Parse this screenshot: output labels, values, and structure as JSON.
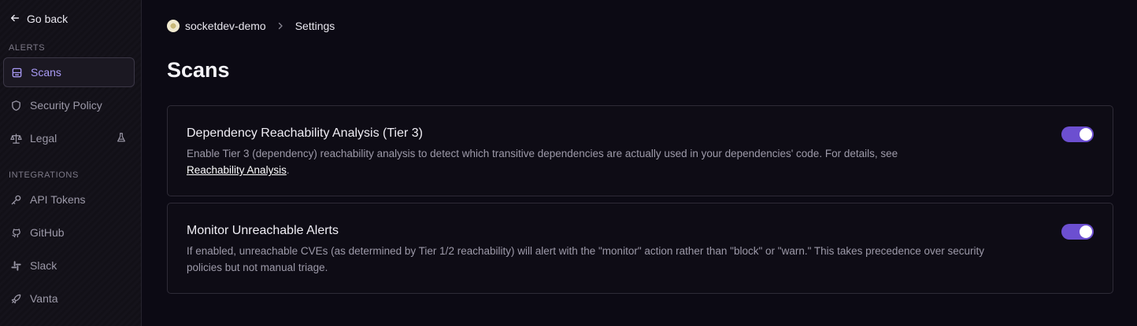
{
  "sidebar": {
    "back_label": "Go back",
    "sections": [
      {
        "label": "ALERTS"
      },
      {
        "label": "INTEGRATIONS"
      }
    ],
    "items": [
      {
        "label": "Scans",
        "icon": "scans-icon"
      },
      {
        "label": "Security Policy",
        "icon": "shield-icon"
      },
      {
        "label": "Legal",
        "icon": "scale-icon",
        "badge_icon": "flask-icon"
      },
      {
        "label": "API Tokens",
        "icon": "key-icon"
      },
      {
        "label": "GitHub",
        "icon": "github-icon"
      },
      {
        "label": "Slack",
        "icon": "slack-icon"
      },
      {
        "label": "Vanta",
        "icon": "vanta-icon"
      }
    ]
  },
  "breadcrumb": {
    "org": "socketdev-demo",
    "page": "Settings"
  },
  "page": {
    "title": "Scans"
  },
  "settings": [
    {
      "title": "Dependency Reachability Analysis (Tier 3)",
      "description": "Enable Tier 3 (dependency) reachability analysis to detect which transitive dependencies are actually used in your dependencies' code. For details, see",
      "link_text": "Reachability Analysis",
      "after_link": ".",
      "enabled": true
    },
    {
      "title": "Monitor Unreachable Alerts",
      "description": "If enabled, unreachable CVEs (as determined by Tier 1/2 reachability) will alert with the \"monitor\" action rather than \"block\" or \"warn.\" This takes precedence over security policies but not manual triage.",
      "enabled": true
    }
  ],
  "colors": {
    "accent": "#6c4fd0",
    "active_nav_text": "#a99af5",
    "background": "#0c0a14"
  }
}
